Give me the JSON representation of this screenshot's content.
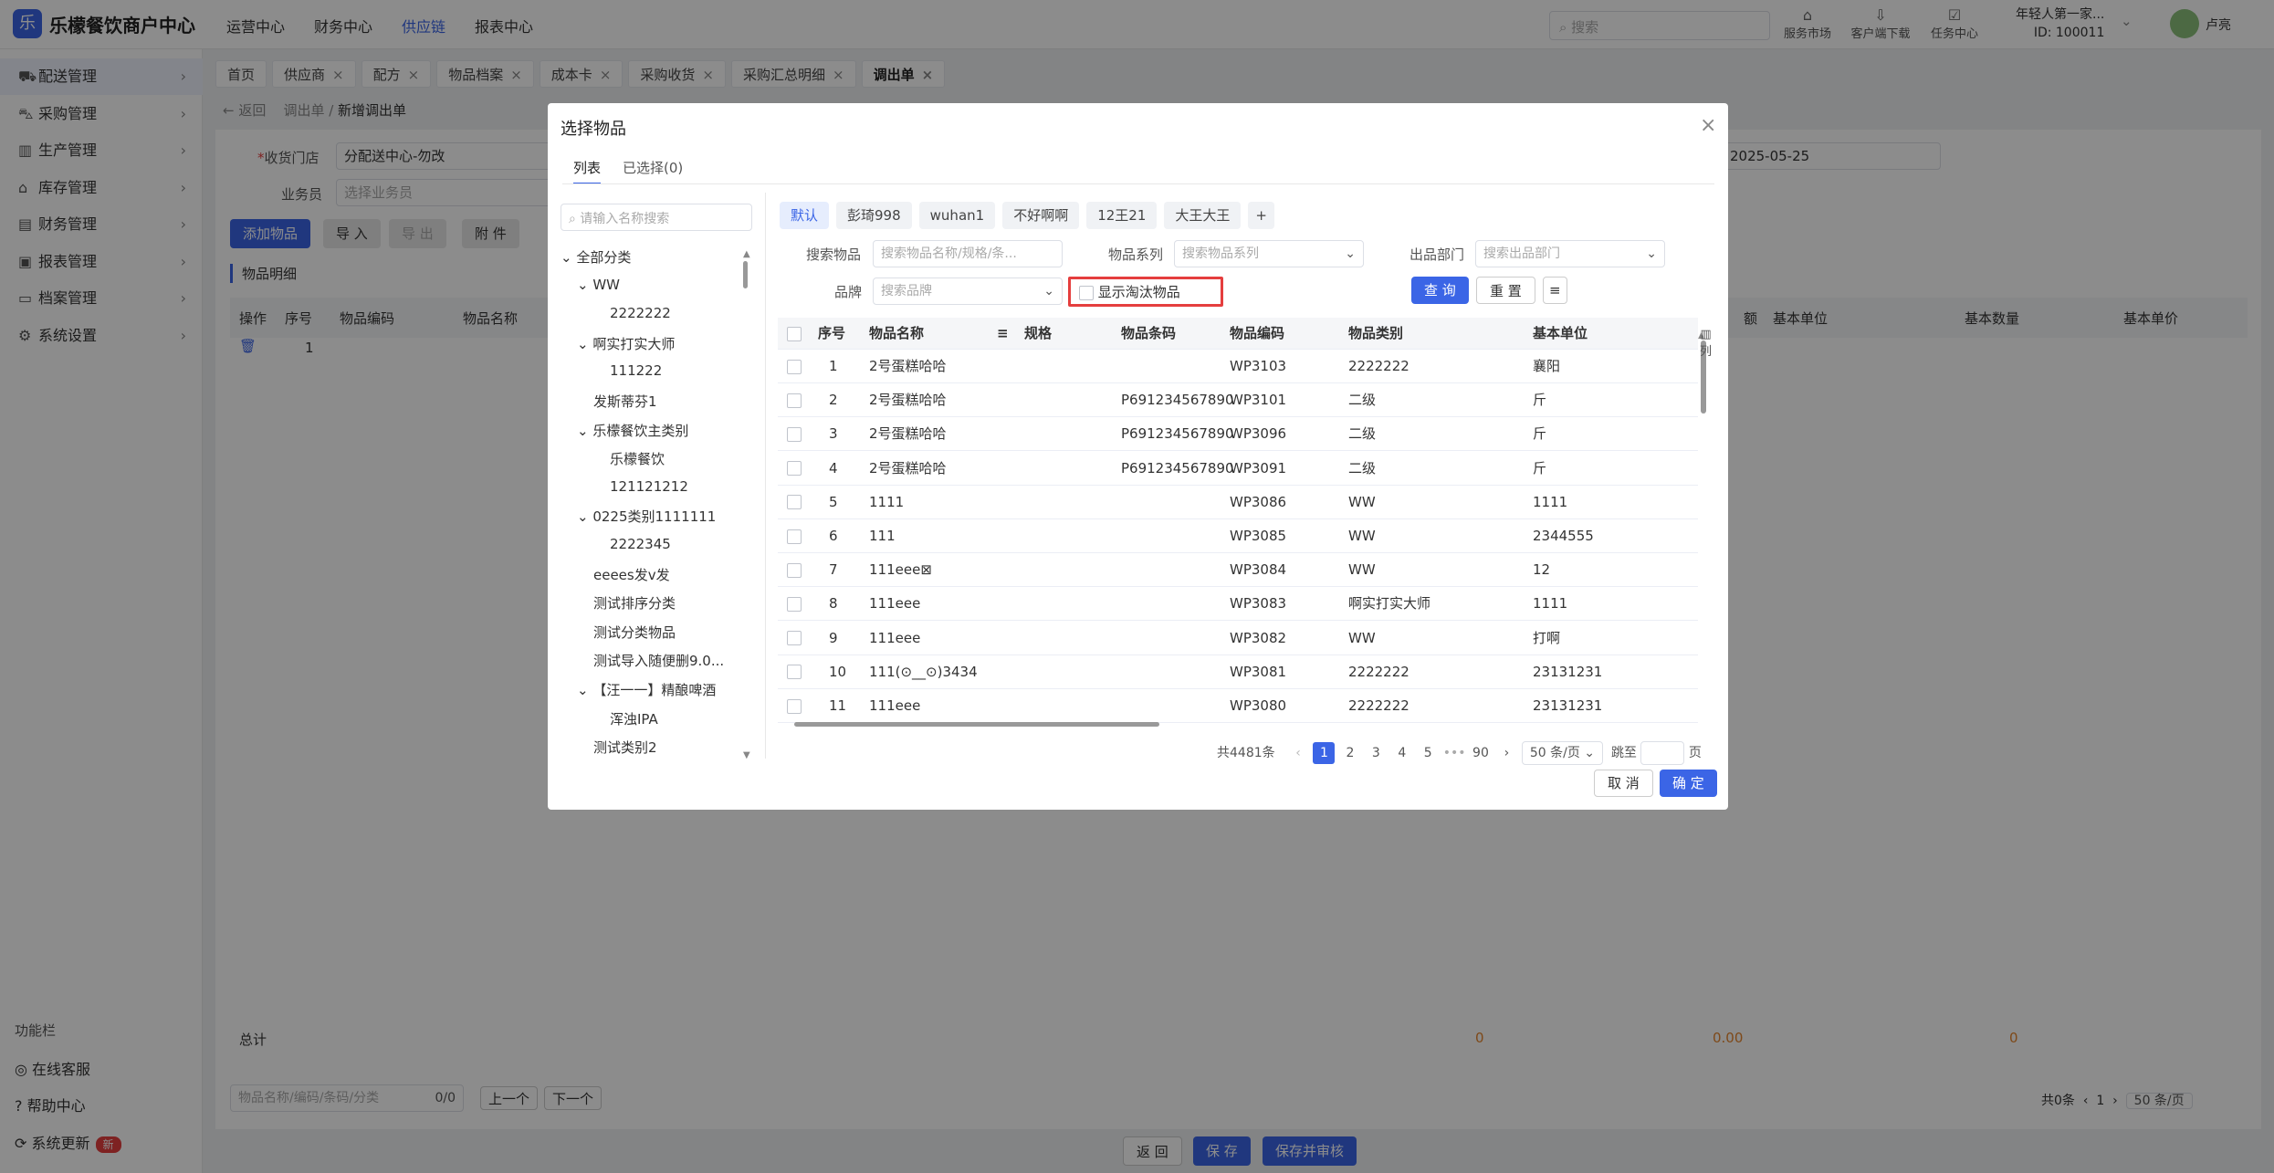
{
  "app": {
    "logo_glyph": "乐",
    "brand": "乐檬餐饮商户中心"
  },
  "topnav": [
    "运营中心",
    "财务中心",
    "供应链",
    "报表中心"
  ],
  "topnav_active": 2,
  "search_placeholder": "搜索",
  "top_icons": [
    {
      "label": "服务市场",
      "icon": "shop-icon"
    },
    {
      "label": "客户端下载",
      "icon": "download-icon"
    },
    {
      "label": "任务中心",
      "icon": "task-icon"
    }
  ],
  "account": {
    "name": "年轻人第一家...",
    "id": "ID: 100011",
    "user": "卢亮"
  },
  "sidebar": [
    {
      "label": "配送管理",
      "icon": "truck-icon"
    },
    {
      "label": "采购管理",
      "icon": "cart-icon"
    },
    {
      "label": "生产管理",
      "icon": "chart-icon"
    },
    {
      "label": "库存管理",
      "icon": "warehouse-icon"
    },
    {
      "label": "财务管理",
      "icon": "finance-icon"
    },
    {
      "label": "报表管理",
      "icon": "report-icon"
    },
    {
      "label": "档案管理",
      "icon": "archive-icon"
    },
    {
      "label": "系统设置",
      "icon": "gear-icon"
    }
  ],
  "func_bar": {
    "title": "功能栏",
    "items": [
      "在线客服",
      "帮助中心",
      "系统更新"
    ],
    "new_badge": "新"
  },
  "tabs": [
    "首页",
    "供应商",
    "配方",
    "物品档案",
    "成本卡",
    "采购收货",
    "采购汇总明细",
    "调出单"
  ],
  "breadcrumb": {
    "back": "返回",
    "parent": "调出单",
    "current": "新增调出单"
  },
  "form": {
    "store_label": "收货门店",
    "store_value": "分配送中心-勿改",
    "clerk_label": "业务员",
    "clerk_placeholder": "选择业务员",
    "date_value": "2025-05-25"
  },
  "actions": {
    "add": "添加物品",
    "import": "导 入",
    "export": "导 出",
    "attach": "附 件"
  },
  "detail_title": "物品明细",
  "bg_table": {
    "headers": [
      "操作",
      "序号",
      "物品编码",
      "物品名称"
    ],
    "right_headers": [
      "额",
      "基本单位",
      "基本数量",
      "基本单价"
    ],
    "row_no": "1",
    "total_label": "总计",
    "totals": [
      "0",
      "0.00",
      "0"
    ],
    "col_label": "列"
  },
  "bottom_search": {
    "placeholder": "物品名称/编码/条码/分类",
    "count": "0/0",
    "prev": "上一个",
    "next": "下一个"
  },
  "bg_pager": {
    "total": "共0条",
    "page": "1",
    "size": "50 条/页"
  },
  "footer_buttons": {
    "back": "返 回",
    "save": "保 存",
    "save_audit": "保存并审核"
  },
  "modal": {
    "title": "选择物品",
    "tabs": [
      "列表",
      "已选择(0)"
    ],
    "tree_search": "请输入名称搜索",
    "tree": [
      {
        "t": "全部分类",
        "lv": 0,
        "exp": true
      },
      {
        "t": "WW",
        "lv": 1,
        "exp": true
      },
      {
        "t": "2222222",
        "lv": 2
      },
      {
        "t": "啊实打实大师",
        "lv": 1,
        "exp": true
      },
      {
        "t": "111222",
        "lv": 2
      },
      {
        "t": "发斯蒂芬1",
        "lv": 1
      },
      {
        "t": "乐檬餐饮主类别",
        "lv": 1,
        "exp": true
      },
      {
        "t": "乐檬餐饮",
        "lv": 2
      },
      {
        "t": "121121212",
        "lv": 2
      },
      {
        "t": "0225类别1111111",
        "lv": 1,
        "exp": true
      },
      {
        "t": "2222345",
        "lv": 2
      },
      {
        "t": "eeees发v发",
        "lv": 1
      },
      {
        "t": "测试排序分类",
        "lv": 1
      },
      {
        "t": "测试分类物品",
        "lv": 1
      },
      {
        "t": "测试导入随便删9.0...",
        "lv": 1
      },
      {
        "t": "【汪一一】精酿啤酒",
        "lv": 1,
        "exp": true
      },
      {
        "t": "浑浊IPA",
        "lv": 2
      },
      {
        "t": "测试类别2",
        "lv": 1
      }
    ],
    "chips": [
      "默认",
      "彭琦998",
      "wuhan1",
      "不好啊啊",
      "12王21",
      "大王大王"
    ],
    "filters": {
      "item_label": "搜索物品",
      "item_ph": "搜索物品名称/规格/条...",
      "series_label": "物品系列",
      "series_ph": "搜索物品系列",
      "dept_label": "出品部门",
      "dept_ph": "搜索出品部门",
      "brand_label": "品牌",
      "brand_ph": "搜索品牌",
      "obsolete": "显示淘汰物品",
      "query": "查 询",
      "reset": "重 置"
    },
    "columns": [
      "序号",
      "物品名称",
      "规格",
      "物品条码",
      "物品编码",
      "物品类别",
      "基本单位"
    ],
    "rows": [
      [
        "1",
        "2号蛋糕哈哈",
        "",
        "",
        "WP3103",
        "2222222",
        "襄阳"
      ],
      [
        "2",
        "2号蛋糕哈哈",
        "",
        "P691234567890",
        "WP3101",
        "二级",
        "斤"
      ],
      [
        "3",
        "2号蛋糕哈哈",
        "",
        "P691234567890",
        "WP3096",
        "二级",
        "斤"
      ],
      [
        "4",
        "2号蛋糕哈哈",
        "",
        "P691234567890",
        "WP3091",
        "二级",
        "斤"
      ],
      [
        "5",
        "1111",
        "",
        "",
        "WP3086",
        "WW",
        "1111"
      ],
      [
        "6",
        "111",
        "",
        "",
        "WP3085",
        "WW",
        "2344555"
      ],
      [
        "7",
        "111eee⊠",
        "",
        "",
        "WP3084",
        "WW",
        "12"
      ],
      [
        "8",
        "111eee",
        "",
        "",
        "WP3083",
        "啊实打实大师",
        "1111"
      ],
      [
        "9",
        "111eee",
        "",
        "",
        "WP3082",
        "WW",
        "打啊"
      ],
      [
        "10",
        "111(⊙__⊙)3434",
        "",
        "",
        "WP3081",
        "2222222",
        "23131231"
      ],
      [
        "11",
        "111eee",
        "",
        "",
        "WP3080",
        "2222222",
        "23131231"
      ]
    ],
    "col_label": "列",
    "pager": {
      "total": "共4481条",
      "pages": [
        "1",
        "2",
        "3",
        "4",
        "5"
      ],
      "ellipsis": "•••",
      "last": "90",
      "size": "50 条/页",
      "jump": "跳至",
      "page_unit": "页"
    },
    "cancel": "取 消",
    "confirm": "确 定"
  },
  "colors": {
    "primary": "#3b65e6",
    "highlight": "#e53e3e",
    "total": "#e6862e"
  }
}
